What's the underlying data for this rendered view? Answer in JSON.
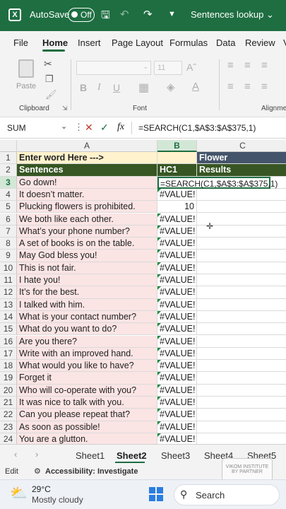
{
  "titlebar": {
    "app_icon": "excel-icon",
    "autosave_label": "AutoSave",
    "autosave_state": "Off",
    "doc_title": "Sentences lookup",
    "color": "#1e6e41"
  },
  "menu": {
    "tabs": [
      "File",
      "Home",
      "Insert",
      "Page Layout",
      "Formulas",
      "Data",
      "Review",
      "V"
    ],
    "active": "Home"
  },
  "ribbon": {
    "paste_label": "Paste",
    "clipboard_label": "Clipboard",
    "font_label": "Font",
    "font_size": "11",
    "alignment_label": "Alignme"
  },
  "formula_bar": {
    "name_box": "SUM",
    "fx_label": "fx",
    "formula": "=SEARCH(C1,$A$3:$A$375,1)"
  },
  "columns": [
    "A",
    "B",
    "C"
  ],
  "rows": [
    {
      "n": "1",
      "a": "Enter word Here --->",
      "b": "",
      "c": "Flower"
    },
    {
      "n": "2",
      "a": "Sentences",
      "b": "HC1",
      "c": "Results"
    },
    {
      "n": "3",
      "a": "Go down!",
      "b": "=SEARCH(C1,$A$3:$A$375,1)",
      "c": ""
    },
    {
      "n": "4",
      "a": "It doesn’t matter.",
      "b": "#VALUE!",
      "c": ""
    },
    {
      "n": "5",
      "a": "Plucking flowers is prohibited.",
      "b": "10",
      "c": ""
    },
    {
      "n": "6",
      "a": "We both like each other.",
      "b": "#VALUE!",
      "c": ""
    },
    {
      "n": "7",
      "a": "What’s your phone number?",
      "b": "#VALUE!",
      "c": ""
    },
    {
      "n": "8",
      "a": "A set of books is on the table.",
      "b": "#VALUE!",
      "c": ""
    },
    {
      "n": "9",
      "a": "May God bless you!",
      "b": "#VALUE!",
      "c": ""
    },
    {
      "n": "10",
      "a": "This is not fair.",
      "b": "#VALUE!",
      "c": ""
    },
    {
      "n": "11",
      "a": "I hate you!",
      "b": "#VALUE!",
      "c": ""
    },
    {
      "n": "12",
      "a": "It’s for the best.",
      "b": "#VALUE!",
      "c": ""
    },
    {
      "n": "13",
      "a": "I talked with him.",
      "b": "#VALUE!",
      "c": ""
    },
    {
      "n": "14",
      "a": "What is your contact number?",
      "b": "#VALUE!",
      "c": ""
    },
    {
      "n": "15",
      "a": "What do you want to do?",
      "b": "#VALUE!",
      "c": ""
    },
    {
      "n": "16",
      "a": "Are you there?",
      "b": "#VALUE!",
      "c": ""
    },
    {
      "n": "17",
      "a": "Write with an improved hand.",
      "b": "#VALUE!",
      "c": ""
    },
    {
      "n": "18",
      "a": "What would you like to have?",
      "b": "#VALUE!",
      "c": ""
    },
    {
      "n": "19",
      "a": "Forget it",
      "b": "#VALUE!",
      "c": ""
    },
    {
      "n": "20",
      "a": "Who will co-operate with you?",
      "b": "#VALUE!",
      "c": ""
    },
    {
      "n": "21",
      "a": "It was nice to talk with you.",
      "b": "#VALUE!",
      "c": ""
    },
    {
      "n": "22",
      "a": "Can you please repeat that?",
      "b": "#VALUE!",
      "c": ""
    },
    {
      "n": "23",
      "a": "As soon as possible!",
      "b": "#VALUE!",
      "c": ""
    },
    {
      "n": "24",
      "a": "You are a glutton.",
      "b": "#VALUE!",
      "c": ""
    }
  ],
  "sheets": {
    "tabs": [
      "Sheet1",
      "Sheet2",
      "Sheet3",
      "Sheet4",
      "Sheet5"
    ],
    "active": "Sheet2"
  },
  "status": {
    "mode": "Edit",
    "accessibility": "Accessibility: Investigate"
  },
  "taskbar": {
    "temperature": "29°C",
    "weather": "Mostly cloudy",
    "search_label": "Search"
  },
  "watermark": {
    "line1": "VIKOM INSTITUTE",
    "line2": "BY PARTNER"
  }
}
